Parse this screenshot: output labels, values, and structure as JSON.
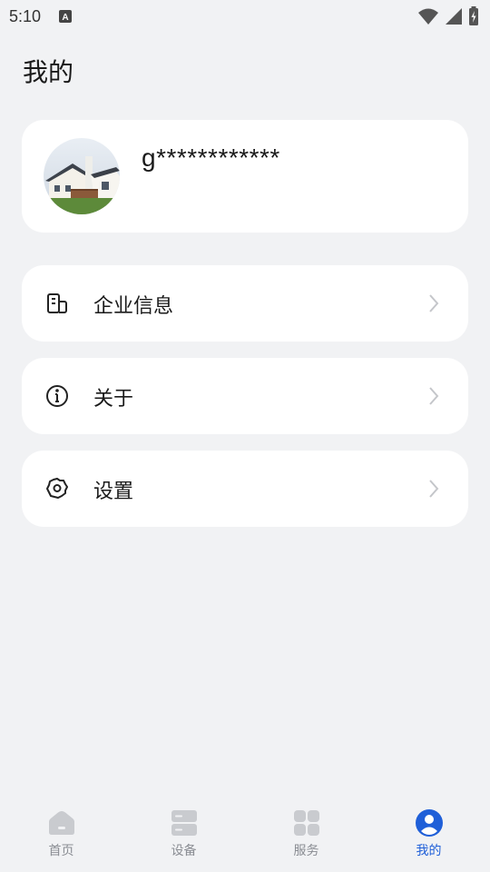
{
  "status_bar": {
    "time": "5:10",
    "notification_icon": "a-letter-icon",
    "icons": [
      "wifi-icon",
      "cellular-signal-icon",
      "battery-charging-icon"
    ]
  },
  "page": {
    "title": "我的"
  },
  "profile": {
    "username": "g************",
    "avatar": "house-photo"
  },
  "menu": {
    "items": [
      {
        "label": "企业信息",
        "icon": "building-icon"
      },
      {
        "label": "关于",
        "icon": "info-icon"
      },
      {
        "label": "设置",
        "icon": "gear-icon"
      }
    ]
  },
  "bottom_nav": {
    "items": [
      {
        "label": "首页",
        "icon": "home-icon",
        "active": false
      },
      {
        "label": "设备",
        "icon": "device-icon",
        "active": false
      },
      {
        "label": "服务",
        "icon": "grid-icon",
        "active": false
      },
      {
        "label": "我的",
        "icon": "user-icon",
        "active": true
      }
    ],
    "active_color": "#1f5fd8",
    "inactive_color": "#8a8d93"
  },
  "colors": {
    "background": "#f1f2f4",
    "card": "#ffffff"
  }
}
